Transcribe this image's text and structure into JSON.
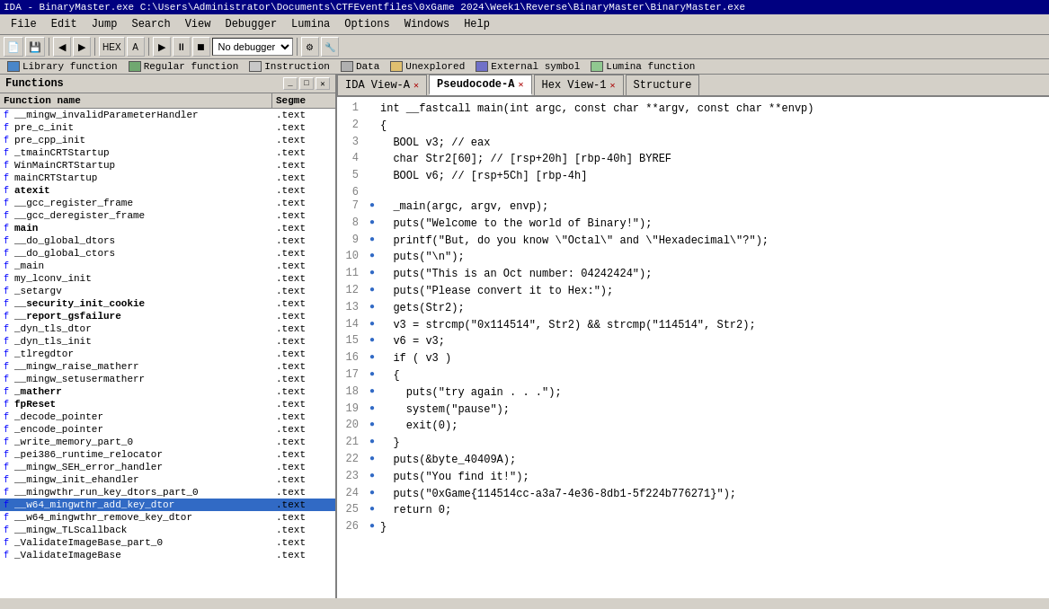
{
  "title_bar": {
    "text": "IDA - BinaryMaster.exe C:\\Users\\Administrator\\Documents\\CTFEventfiles\\0xGame 2024\\Week1\\Reverse\\BinaryMaster\\BinaryMaster.exe"
  },
  "menu": {
    "items": [
      "File",
      "Edit",
      "Jump",
      "Search",
      "View",
      "Debugger",
      "Lumina",
      "Options",
      "Windows",
      "Help"
    ]
  },
  "toolbar": {
    "debugger_select": "No debugger",
    "debugger_options": [
      "No debugger"
    ]
  },
  "legend": {
    "items": [
      {
        "label": "Library function",
        "color": "#4a86c8"
      },
      {
        "label": "Regular function",
        "color": "#70a870"
      },
      {
        "label": "Instruction",
        "color": "#c8c8c8"
      },
      {
        "label": "Data",
        "color": "#b0b0b0"
      },
      {
        "label": "Unexplored",
        "color": "#e0c070"
      },
      {
        "label": "External symbol",
        "color": "#7070c8"
      },
      {
        "label": "Lumina function",
        "color": "#90c890"
      }
    ]
  },
  "functions_panel": {
    "title": "Functions",
    "col_name": "Function name",
    "col_seg": "Segme",
    "functions": [
      {
        "name": "__mingw_invalidParameterHandler",
        "seg": ".text",
        "bold": false
      },
      {
        "name": "pre_c_init",
        "seg": ".text",
        "bold": false
      },
      {
        "name": "pre_cpp_init",
        "seg": ".text",
        "bold": false
      },
      {
        "name": "_tmainCRTStartup",
        "seg": ".text",
        "bold": false
      },
      {
        "name": "WinMainCRTStartup",
        "seg": ".text",
        "bold": false
      },
      {
        "name": "mainCRTStartup",
        "seg": ".text",
        "bold": false
      },
      {
        "name": "atexit",
        "seg": ".text",
        "bold": true
      },
      {
        "name": "__gcc_register_frame",
        "seg": ".text",
        "bold": false
      },
      {
        "name": "__gcc_deregister_frame",
        "seg": ".text",
        "bold": false
      },
      {
        "name": "main",
        "seg": ".text",
        "bold": true
      },
      {
        "name": "__do_global_dtors",
        "seg": ".text",
        "bold": false
      },
      {
        "name": "__do_global_ctors",
        "seg": ".text",
        "bold": false
      },
      {
        "name": "_main",
        "seg": ".text",
        "bold": false
      },
      {
        "name": "my_lconv_init",
        "seg": ".text",
        "bold": false
      },
      {
        "name": "_setargv",
        "seg": ".text",
        "bold": false
      },
      {
        "name": "__security_init_cookie",
        "seg": ".text",
        "bold": true
      },
      {
        "name": "__report_gsfailure",
        "seg": ".text",
        "bold": true
      },
      {
        "name": "_dyn_tls_dtor",
        "seg": ".text",
        "bold": false
      },
      {
        "name": "_dyn_tls_init",
        "seg": ".text",
        "bold": false
      },
      {
        "name": "_tlregdtor",
        "seg": ".text",
        "bold": false
      },
      {
        "name": "__mingw_raise_matherr",
        "seg": ".text",
        "bold": false
      },
      {
        "name": "__mingw_setusermatherr",
        "seg": ".text",
        "bold": false
      },
      {
        "name": "_matherr",
        "seg": ".text",
        "bold": true
      },
      {
        "name": "fpReset",
        "seg": ".text",
        "bold": true
      },
      {
        "name": "_decode_pointer",
        "seg": ".text",
        "bold": false
      },
      {
        "name": "_encode_pointer",
        "seg": ".text",
        "bold": false
      },
      {
        "name": "_write_memory_part_0",
        "seg": ".text",
        "bold": false
      },
      {
        "name": "_pei386_runtime_relocator",
        "seg": ".text",
        "bold": false
      },
      {
        "name": "__mingw_SEH_error_handler",
        "seg": ".text",
        "bold": false
      },
      {
        "name": "__mingw_init_ehandler",
        "seg": ".text",
        "bold": false
      },
      {
        "name": "__mingwthr_run_key_dtors_part_0",
        "seg": ".text",
        "bold": false
      },
      {
        "name": "__w64_mingwthr_add_key_dtor",
        "seg": ".text",
        "bold": false,
        "selected": true
      },
      {
        "name": "__w64_mingwthr_remove_key_dtor",
        "seg": ".text",
        "bold": false
      },
      {
        "name": "__mingw_TLScallback",
        "seg": ".text",
        "bold": false
      },
      {
        "name": "_ValidateImageBase_part_0",
        "seg": ".text",
        "bold": false
      },
      {
        "name": "_ValidateImageBase",
        "seg": ".text",
        "bold": false
      }
    ]
  },
  "tabs": [
    {
      "label": "IDA View-A",
      "active": false,
      "closable": true
    },
    {
      "label": "Pseudocode-A",
      "active": true,
      "closable": true
    },
    {
      "label": "Hex View-1",
      "active": false,
      "closable": true
    },
    {
      "label": "Structure",
      "active": false,
      "closable": false
    }
  ],
  "code": {
    "lines": [
      {
        "num": 1,
        "dot": false,
        "text": "int __fastcall main(int argc, const char **argv, const char **envp)"
      },
      {
        "num": 2,
        "dot": false,
        "text": "{"
      },
      {
        "num": 3,
        "dot": false,
        "text": "  BOOL v3; // eax"
      },
      {
        "num": 4,
        "dot": false,
        "text": "  char Str2[60]; // [rsp+20h] [rbp-40h] BYREF"
      },
      {
        "num": 5,
        "dot": false,
        "text": "  BOOL v6; // [rsp+5Ch] [rbp-4h]"
      },
      {
        "num": 6,
        "dot": false,
        "text": ""
      },
      {
        "num": 7,
        "dot": true,
        "text": "  _main(argc, argv, envp);"
      },
      {
        "num": 8,
        "dot": true,
        "text": "  puts(\"Welcome to the world of Binary!\");"
      },
      {
        "num": 9,
        "dot": true,
        "text": "  printf(\"But, do you know \\\"Octal\\\" and \\\"Hexadecimal\\\"?\");"
      },
      {
        "num": 10,
        "dot": true,
        "text": "  puts(\"\\n\");"
      },
      {
        "num": 11,
        "dot": true,
        "text": "  puts(\"This is an Oct number: 04242424\");"
      },
      {
        "num": 12,
        "dot": true,
        "text": "  puts(\"Please convert it to Hex:\");"
      },
      {
        "num": 13,
        "dot": true,
        "text": "  gets(Str2);"
      },
      {
        "num": 14,
        "dot": true,
        "text": "  v3 = strcmp(\"0x114514\", Str2) && strcmp(\"114514\", Str2);"
      },
      {
        "num": 15,
        "dot": true,
        "text": "  v6 = v3;"
      },
      {
        "num": 16,
        "dot": true,
        "text": "  if ( v3 )"
      },
      {
        "num": 17,
        "dot": true,
        "text": "  {"
      },
      {
        "num": 18,
        "dot": true,
        "text": "    puts(\"try again . . .\");"
      },
      {
        "num": 19,
        "dot": true,
        "text": "    system(\"pause\");"
      },
      {
        "num": 20,
        "dot": true,
        "text": "    exit(0);"
      },
      {
        "num": 21,
        "dot": true,
        "text": "  }"
      },
      {
        "num": 22,
        "dot": true,
        "text": "  puts(&byte_40409A);"
      },
      {
        "num": 23,
        "dot": true,
        "text": "  puts(\"You find it!\");"
      },
      {
        "num": 24,
        "dot": true,
        "text": "  puts(\"0xGame{114514cc-a3a7-4e36-8db1-5f224b776271}\");"
      },
      {
        "num": 25,
        "dot": true,
        "text": "  return 0;"
      },
      {
        "num": 26,
        "dot": true,
        "text": "}"
      }
    ]
  }
}
